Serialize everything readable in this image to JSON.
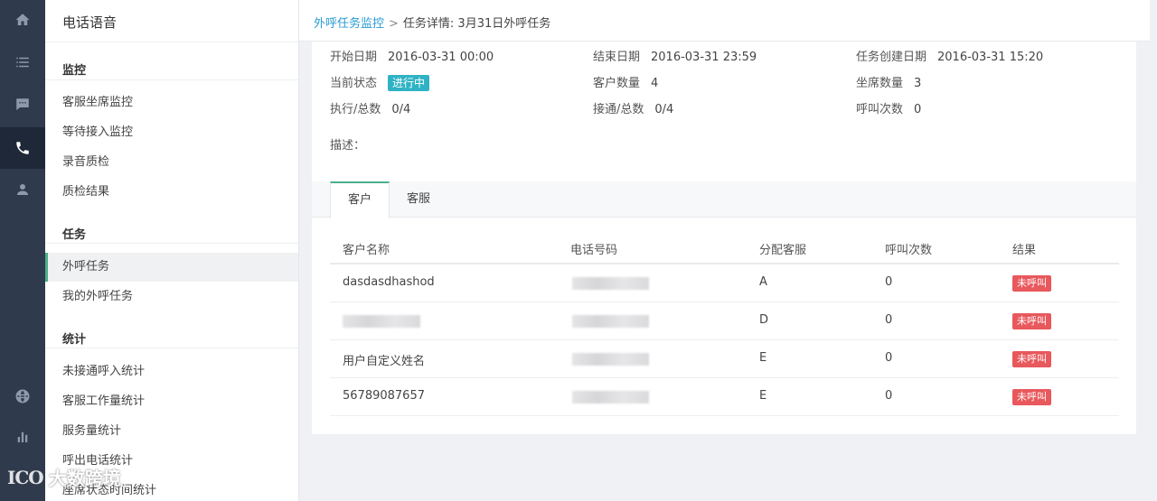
{
  "rail": {
    "items": [
      {
        "icon": "home-icon"
      },
      {
        "icon": "list-icon"
      },
      {
        "icon": "chat-icon"
      },
      {
        "icon": "phone-icon",
        "active": true
      },
      {
        "icon": "user-icon"
      },
      {
        "icon": "globe-icon"
      },
      {
        "icon": "bar-chart-icon"
      }
    ]
  },
  "sidebar": {
    "title": "电话语音",
    "sections": [
      {
        "heading": "监控",
        "items": [
          "客服坐席监控",
          "等待接入监控",
          "录音质检",
          "质检结果"
        ]
      },
      {
        "heading": "任务",
        "items": [
          "外呼任务",
          "我的外呼任务"
        ]
      },
      {
        "heading": "统计",
        "items": [
          "未接通呼入统计",
          "客服工作量统计",
          "服务量统计",
          "呼出电话统计",
          "座席状态时间统计"
        ]
      }
    ],
    "active_item": "外呼任务"
  },
  "breadcrumb": {
    "link": "外呼任务监控",
    "separator": ">",
    "current": "任务详情: 3月31日外呼任务"
  },
  "info": {
    "start_label": "开始日期",
    "start_value": "2016-03-31 00:00",
    "end_label": "结束日期",
    "end_value": "2016-03-31 23:59",
    "created_label": "任务创建日期",
    "created_value": "2016-03-31 15:20",
    "status_label": "当前状态",
    "status_value": "进行中",
    "customers_label": "客户数量",
    "customers_value": "4",
    "agents_label": "坐席数量",
    "agents_value": "3",
    "exec_label": "执行/总数",
    "exec_value": "0/4",
    "connected_label": "接通/总数",
    "connected_value": "0/4",
    "calls_label": "呼叫次数",
    "calls_value": "0",
    "desc_label": "描述："
  },
  "tabs": [
    "客户",
    "客服"
  ],
  "table": {
    "headers": [
      "客户名称",
      "电话号码",
      "分配客服",
      "呼叫次数",
      "结果"
    ],
    "rows": [
      {
        "name": "dasdasdhashod",
        "agent": "A",
        "calls": "0",
        "result": "未呼叫"
      },
      {
        "name": "",
        "agent": "D",
        "calls": "0",
        "result": "未呼叫"
      },
      {
        "name": "用户自定义姓名",
        "agent": "E",
        "calls": "0",
        "result": "未呼叫"
      },
      {
        "name": "56789087657",
        "agent": "E",
        "calls": "0",
        "result": "未呼叫"
      }
    ]
  },
  "watermark": {
    "logo": "ICO",
    "text": "大数跨境"
  },
  "colors": {
    "accent": "#4caf8a",
    "link": "#2a9bd4",
    "running_badge": "#2fb3c4",
    "not_called_tag": "#e8585c",
    "rail_bg": "#2f3a4c"
  }
}
